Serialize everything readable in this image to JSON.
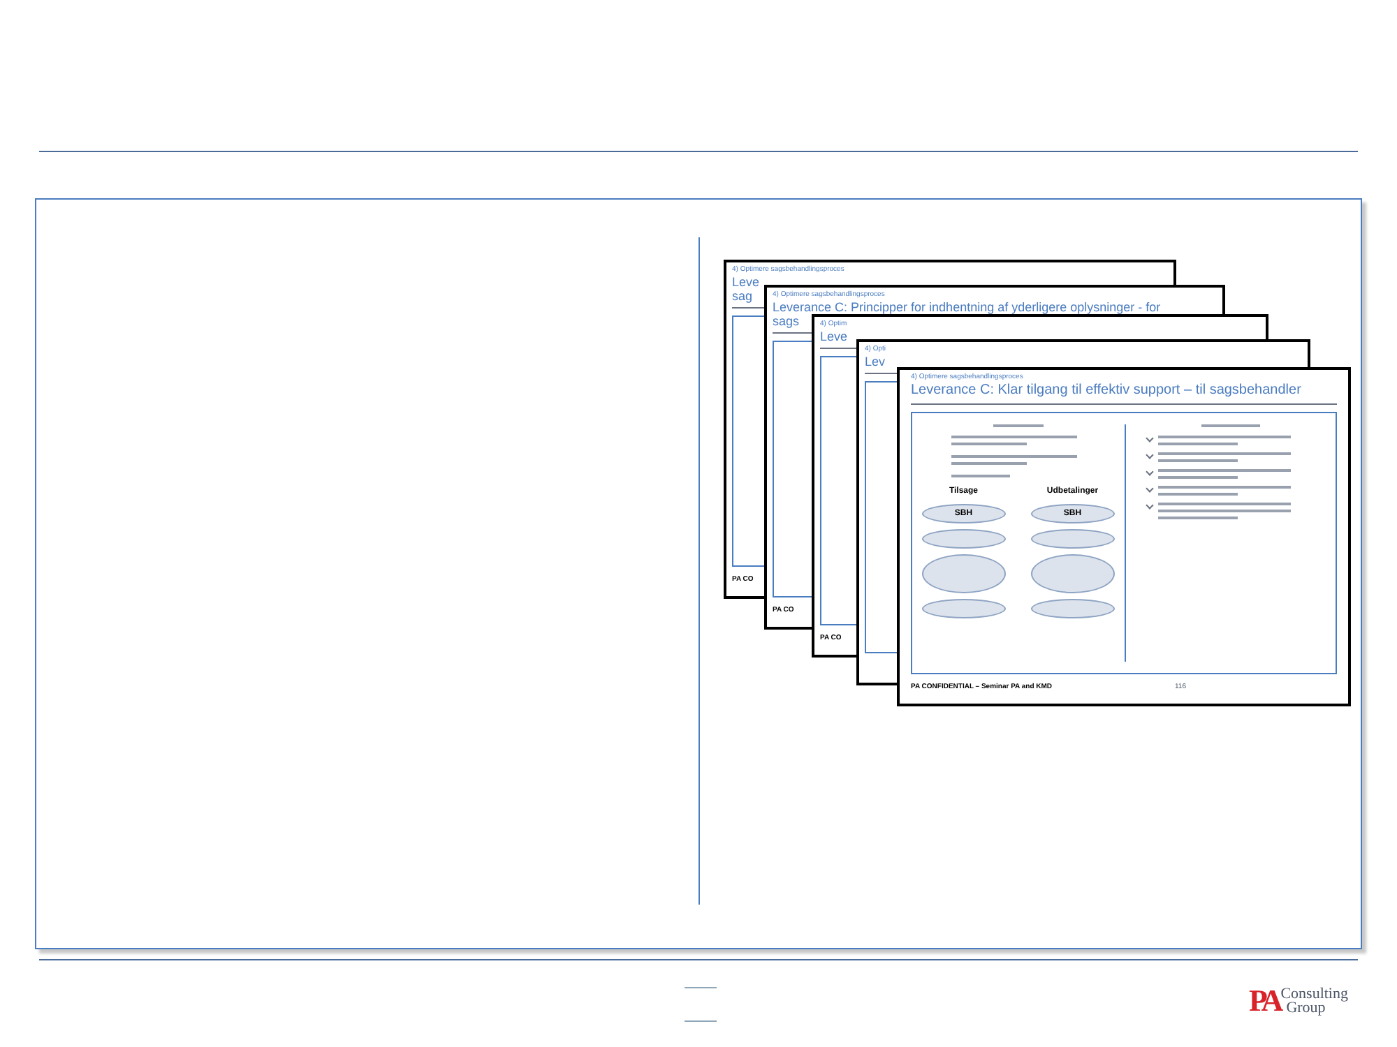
{
  "slides": [
    {
      "subtitle": "4) Optimere sagsbehandlingsproces",
      "title_lines": [
        "Leve",
        "sag"
      ],
      "footer": "PA CO"
    },
    {
      "subtitle": "4) Optimere sagsbehandlingsproces",
      "title_lines": [
        "Leverance C: Principper for indhentning af yderligere oplysninger - for",
        "sags"
      ],
      "footer": "PA CO"
    },
    {
      "subtitle": "4) Optim",
      "title_lines": [
        "Leve"
      ],
      "footer": "PA CO"
    },
    {
      "subtitle": "4) Opti",
      "title_lines": [
        "Lev"
      ]
    },
    {
      "subtitle": "4) Optimere sagsbehandlingsproces",
      "title_lines": [
        "Leverance C: Klar tilgang til effektiv support – til sagsbehandler"
      ],
      "footer": "PA CONFIDENTIAL – Seminar PA and KMD",
      "page": "116"
    }
  ],
  "flow": {
    "columns": [
      {
        "heading": "Tilsage",
        "nodes": [
          "SBH"
        ]
      },
      {
        "heading": "Udbetalinger",
        "nodes": [
          "SBH"
        ]
      }
    ]
  },
  "logo": {
    "mark": "PA",
    "line1": "Consulting",
    "line2": "Group"
  }
}
